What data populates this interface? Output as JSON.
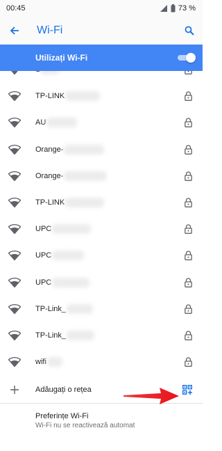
{
  "status_bar": {
    "time": "00:45",
    "battery": "73 %"
  },
  "app_bar": {
    "title": "Wi-Fi"
  },
  "master_switch": {
    "label": "Utilizați Wi-Fi",
    "enabled": true
  },
  "networks": [
    {
      "name": "S",
      "secured": true
    },
    {
      "name": "TP-LINK",
      "secured": true
    },
    {
      "name": "AU",
      "secured": true
    },
    {
      "name": "Orange-",
      "secured": true
    },
    {
      "name": "Orange-",
      "secured": true
    },
    {
      "name": "TP-LINK",
      "secured": true
    },
    {
      "name": "UPC",
      "secured": true
    },
    {
      "name": "UPC",
      "secured": true
    },
    {
      "name": "UPC",
      "secured": true
    },
    {
      "name": "TP-Link_",
      "secured": true
    },
    {
      "name": "TP-Link_",
      "secured": true
    },
    {
      "name": "wifi",
      "secured": true
    }
  ],
  "add_network": {
    "label": "Adăugați o rețea"
  },
  "preferences": {
    "title": "Preferințe Wi-Fi",
    "subtitle": "Wi-Fi nu se reactivează automat"
  },
  "colors": {
    "accent": "#1a73e8",
    "master_bar": "#4285f4",
    "arrow": "#e8141a"
  }
}
